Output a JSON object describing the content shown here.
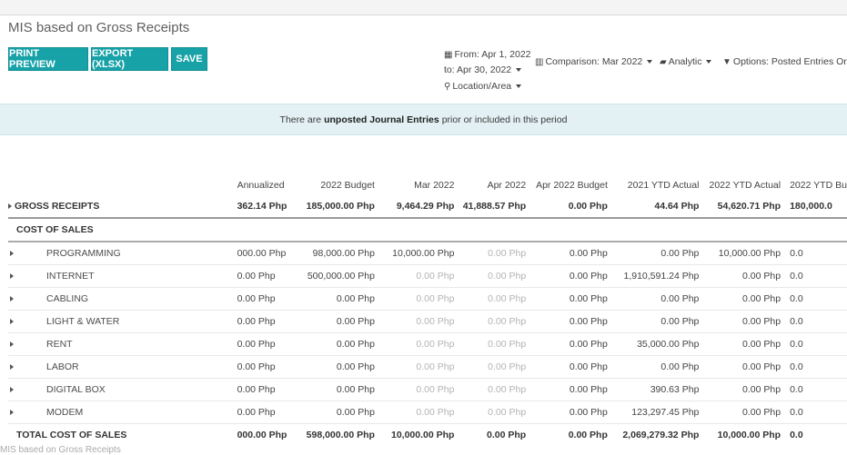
{
  "report": {
    "title": "MIS based on Gross Receipts"
  },
  "toolbar": {
    "print_preview": "PRINT PREVIEW",
    "export": "EXPORT (XLSX)",
    "save": "SAVE"
  },
  "filters": {
    "date_from": "From: Apr 1, 2022",
    "date_to": "to: Apr 30, 2022",
    "location": "Location/Area",
    "comparison": "Comparison: Mar 2022",
    "analytic": "Analytic",
    "options": "Options: Posted Entries Only"
  },
  "banner": {
    "prefix": "There are",
    "emph": "unposted Journal Entries",
    "suffix": "prior or included in this period"
  },
  "columns": [
    "Annualized",
    "2022 Budget",
    "Mar 2022",
    "Apr 2022",
    "Apr 2022 Budget",
    "2021 YTD Actual",
    "2022 YTD Actual",
    "2022 YTD Bu"
  ],
  "gross_receipts": {
    "label": "GROSS RECEIPTS",
    "values": [
      "362.14 Php",
      "185,000.00 Php",
      "9,464.29 Php",
      "41,888.57 Php",
      "0.00 Php",
      "44.64 Php",
      "54,620.71 Php",
      "180,000.0"
    ]
  },
  "cost_of_sales": {
    "label": "COST OF SALES"
  },
  "rows": [
    {
      "label": "PROGRAMMING",
      "values": [
        "000.00 Php",
        "98,000.00 Php",
        "10,000.00 Php",
        "0.00 Php",
        "0.00 Php",
        "0.00 Php",
        "10,000.00 Php",
        "0.0"
      ],
      "dim": [
        false,
        false,
        false,
        true,
        false,
        false,
        false,
        false
      ]
    },
    {
      "label": "INTERNET",
      "values": [
        "0.00 Php",
        "500,000.00 Php",
        "0.00 Php",
        "0.00 Php",
        "0.00 Php",
        "1,910,591.24 Php",
        "0.00 Php",
        "0.0"
      ],
      "dim": [
        false,
        false,
        true,
        true,
        false,
        false,
        false,
        false
      ]
    },
    {
      "label": "CABLING",
      "values": [
        "0.00 Php",
        "0.00 Php",
        "0.00 Php",
        "0.00 Php",
        "0.00 Php",
        "0.00 Php",
        "0.00 Php",
        "0.0"
      ],
      "dim": [
        false,
        false,
        true,
        true,
        false,
        false,
        false,
        false
      ]
    },
    {
      "label": "LIGHT & WATER",
      "values": [
        "0.00 Php",
        "0.00 Php",
        "0.00 Php",
        "0.00 Php",
        "0.00 Php",
        "0.00 Php",
        "0.00 Php",
        "0.0"
      ],
      "dim": [
        false,
        false,
        true,
        true,
        false,
        false,
        false,
        false
      ]
    },
    {
      "label": "RENT",
      "values": [
        "0.00 Php",
        "0.00 Php",
        "0.00 Php",
        "0.00 Php",
        "0.00 Php",
        "35,000.00 Php",
        "0.00 Php",
        "0.0"
      ],
      "dim": [
        false,
        false,
        true,
        true,
        false,
        false,
        false,
        false
      ]
    },
    {
      "label": "LABOR",
      "values": [
        "0.00 Php",
        "0.00 Php",
        "0.00 Php",
        "0.00 Php",
        "0.00 Php",
        "0.00 Php",
        "0.00 Php",
        "0.0"
      ],
      "dim": [
        false,
        false,
        true,
        true,
        false,
        false,
        false,
        false
      ]
    },
    {
      "label": "DIGITAL BOX",
      "values": [
        "0.00 Php",
        "0.00 Php",
        "0.00 Php",
        "0.00 Php",
        "0.00 Php",
        "390.63 Php",
        "0.00 Php",
        "0.0"
      ],
      "dim": [
        false,
        false,
        true,
        true,
        false,
        false,
        false,
        false
      ]
    },
    {
      "label": "MODEM",
      "values": [
        "0.00 Php",
        "0.00 Php",
        "0.00 Php",
        "0.00 Php",
        "0.00 Php",
        "123,297.45 Php",
        "0.00 Php",
        "0.0"
      ],
      "dim": [
        false,
        false,
        true,
        true,
        false,
        false,
        false,
        false
      ]
    }
  ],
  "total": {
    "label": "TOTAL COST OF SALES",
    "values": [
      "000.00 Php",
      "598,000.00 Php",
      "10,000.00 Php",
      "0.00 Php",
      "0.00 Php",
      "2,069,279.32 Php",
      "10,000.00 Php",
      "0.0"
    ]
  },
  "footer_ghost": "MIS based on Gross Receipts"
}
